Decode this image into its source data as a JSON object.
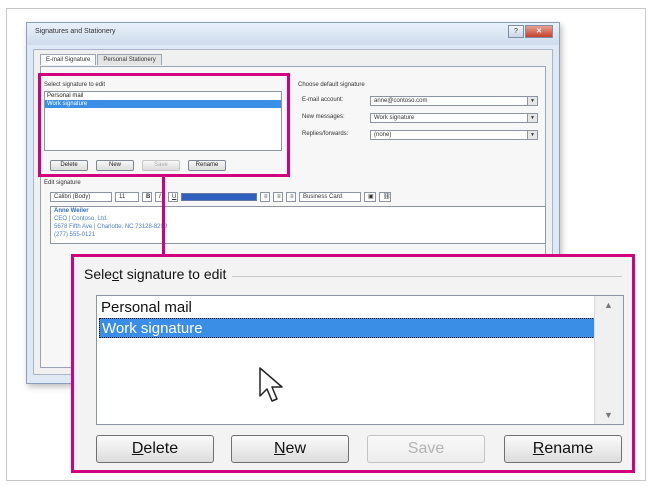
{
  "window": {
    "title": "Signatures and Stationery",
    "tabs": [
      "E-mail Signature",
      "Personal Stationery"
    ]
  },
  "small": {
    "select_label": "Select signature to edit",
    "items": [
      "Personal mail",
      "Work signature"
    ],
    "buttons": [
      "Delete",
      "New",
      "Save",
      "Rename"
    ],
    "default_label": "Choose default signature",
    "rows": [
      {
        "label": "E-mail account:",
        "value": "anne@contoso.com"
      },
      {
        "label": "New messages:",
        "value": "Work signature"
      },
      {
        "label": "Replies/forwards:",
        "value": "(none)"
      }
    ],
    "edit_label": "Edit signature",
    "font": "Calibri (Body)",
    "size": "11",
    "business_card": "Business Card",
    "signature_lines": [
      "Anne Weiler",
      "CEO | Contoso, Ltd.",
      "5678 Fifth Ave | Charlotte, NC 73128-8299",
      "(277) 555-0121"
    ]
  },
  "zoom": {
    "select_label_pre": "Sele",
    "select_label_u": "c",
    "select_label_post": "t signature to edit",
    "items": [
      "Personal mail",
      "Work signature"
    ],
    "buttons": {
      "delete": {
        "u": "D",
        "rest": "elete"
      },
      "new": {
        "u": "N",
        "rest": "ew"
      },
      "save": "Save",
      "rename": {
        "u": "R",
        "rest": "ename"
      }
    }
  },
  "colors": {
    "highlight": "#d0007e",
    "selection": "#3a8ee6"
  }
}
